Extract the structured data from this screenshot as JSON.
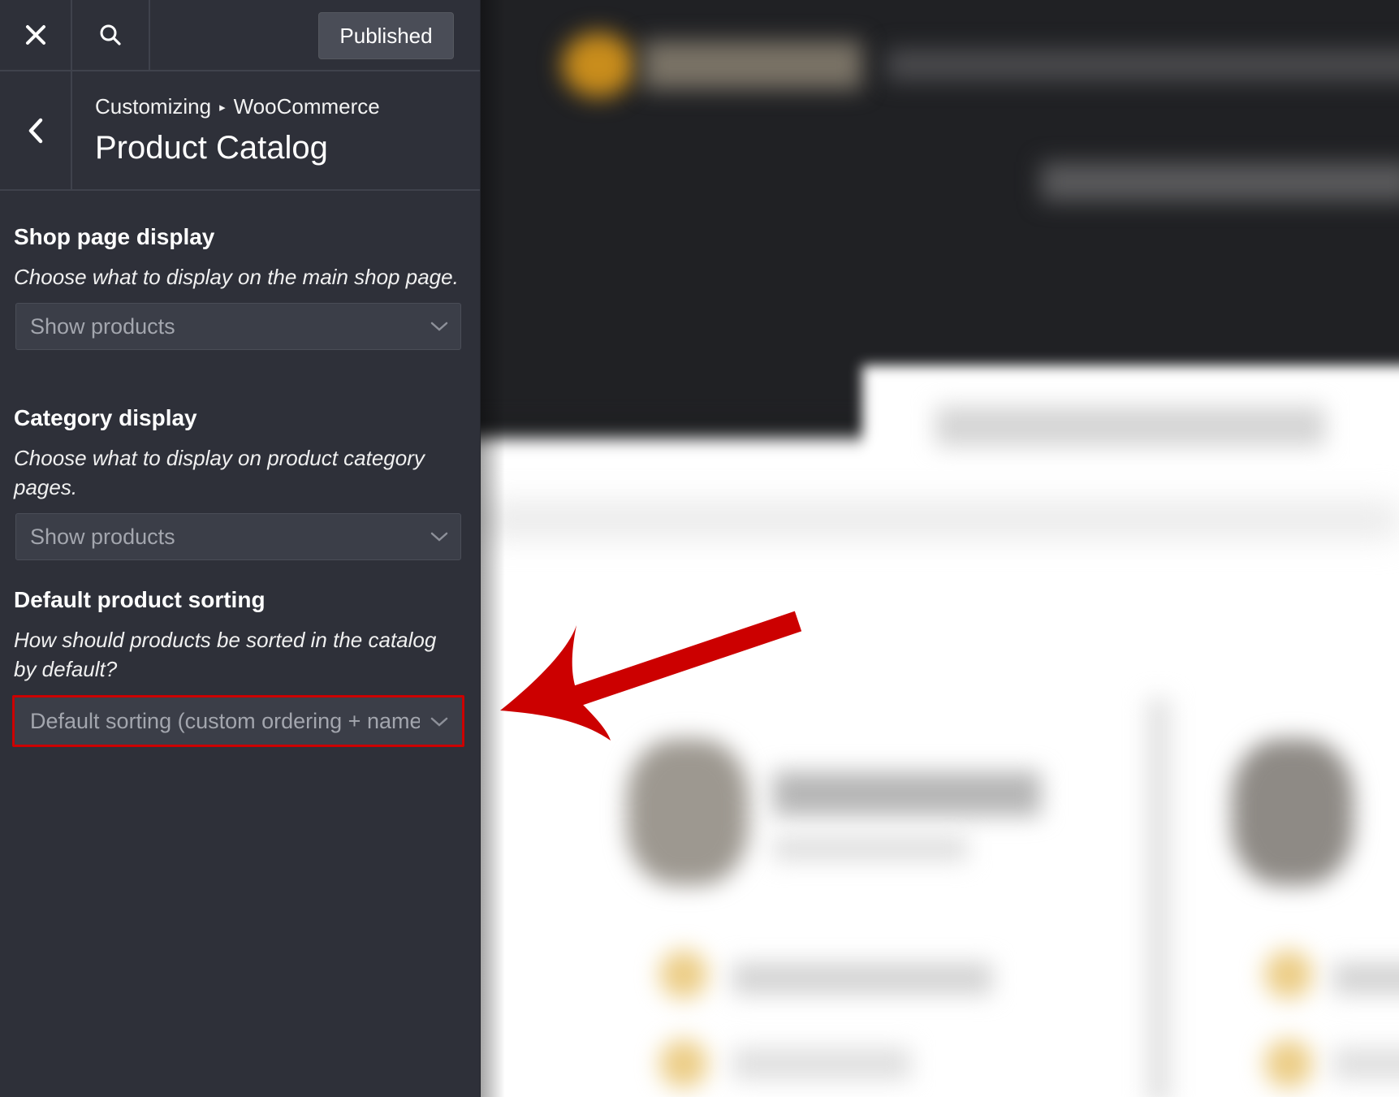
{
  "topbar": {
    "close_icon": "close-icon",
    "search_icon": "search-icon",
    "publish_label": "Published"
  },
  "section": {
    "back_icon": "chevron-left-icon",
    "breadcrumb_root": "Customizing",
    "breadcrumb_separator": "▸",
    "breadcrumb_parent": "WooCommerce",
    "title": "Product Catalog"
  },
  "controls": [
    {
      "label": "Shop page display",
      "description": "Choose what to display on the main shop page.",
      "selected": "Show products"
    },
    {
      "label": "Category display",
      "description": "Choose what to display on product category pages.",
      "selected": "Show products"
    },
    {
      "label": "Default product sorting",
      "description": "How should products be sorted in the catalog by default?",
      "selected": "Default sorting (custom ordering + name)"
    }
  ],
  "colors": {
    "sidebar_bg": "#2e3039",
    "select_bg": "#3b3e48",
    "highlight": "#cc0000",
    "arrow": "#cc0000"
  }
}
